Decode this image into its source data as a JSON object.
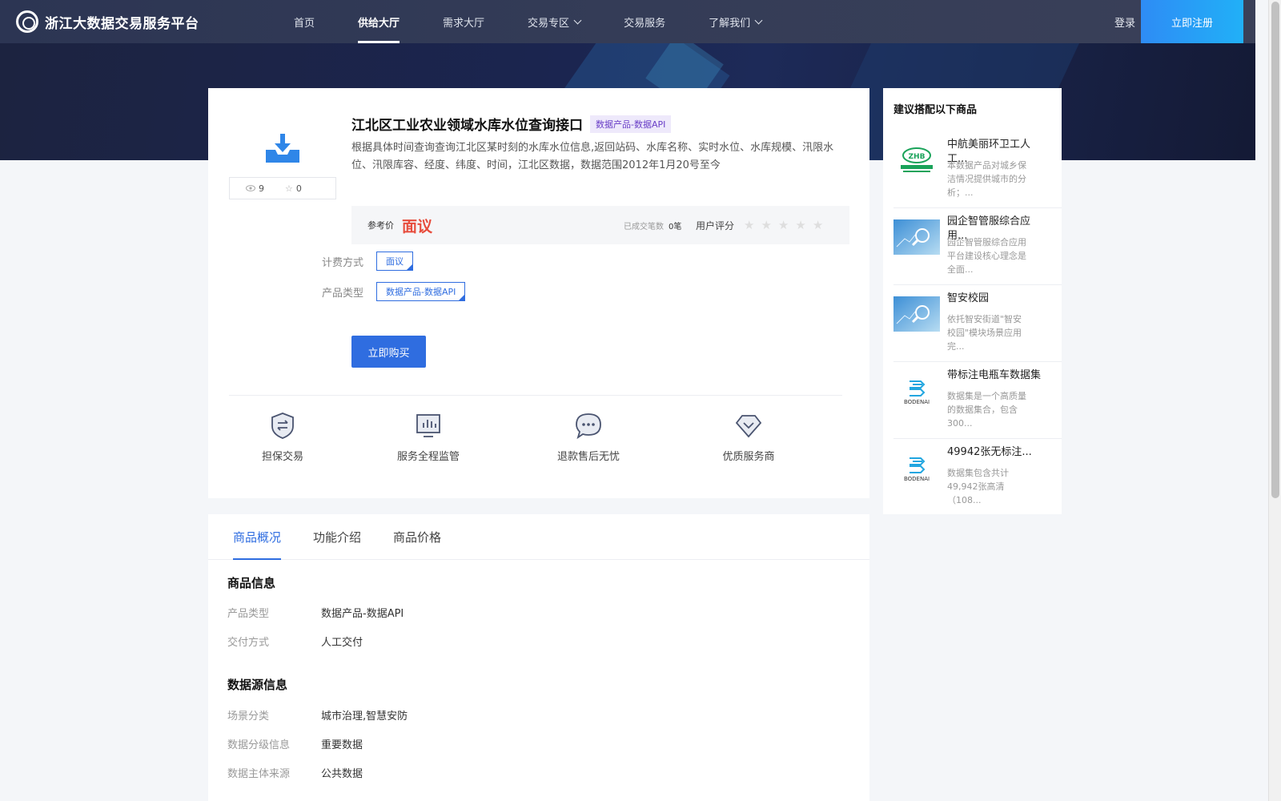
{
  "header": {
    "logo_text": "浙江大数据交易服务平台",
    "nav": [
      {
        "label": "首页"
      },
      {
        "label": "供给大厅"
      },
      {
        "label": "需求大厅"
      },
      {
        "label": "交易专区"
      },
      {
        "label": "交易服务"
      },
      {
        "label": "了解我们"
      }
    ],
    "login": "登录",
    "register": "立即注册"
  },
  "product": {
    "title": "江北区工业农业领域水库水位查询接口",
    "tag": "数据产品-数据API",
    "description": "根据具体时间查询查询江北区某时刻的水库水位信息,返回站码、水库名称、实时水位、水库规模、汛限水位、汛限库容、经度、纬度、时间，江北区数据，数据范围2012年1月20号至今",
    "views": "9",
    "favorites": "0",
    "price_label": "参考价",
    "price_value": "面议",
    "deal_label": "已成交笔数",
    "deal_value": "0笔",
    "rating_label": "用户评分",
    "billing_label": "计费方式",
    "billing_value": "面议",
    "type_label": "产品类型",
    "type_value": "数据产品-数据API",
    "buy_label": "立即购买"
  },
  "features": [
    {
      "label": "担保交易",
      "icon": "shield-swap-icon"
    },
    {
      "label": "服务全程监管",
      "icon": "monitor-chart-icon"
    },
    {
      "label": "退款售后无忧",
      "icon": "chat-bubble-icon"
    },
    {
      "label": "优质服务商",
      "icon": "diamond-icon"
    }
  ],
  "tabs": [
    {
      "label": "商品概况"
    },
    {
      "label": "功能介绍"
    },
    {
      "label": "商品价格"
    }
  ],
  "info": {
    "section1_title": "商品信息",
    "section1": [
      {
        "k": "产品类型",
        "v": "数据产品-数据API"
      },
      {
        "k": "交付方式",
        "v": "人工交付"
      }
    ],
    "section2_title": "数据源信息",
    "section2": [
      {
        "k": "场景分类",
        "v": "城市治理,智慧安防"
      },
      {
        "k": "数据分级信息",
        "v": "重要数据"
      },
      {
        "k": "数据主体来源",
        "v": "公共数据"
      }
    ]
  },
  "sidebar": {
    "title": "建议搭配以下商品",
    "items": [
      {
        "name": "中航美丽环卫工人工...",
        "desc": "本数据产品对城乡保洁情况提供城市的分析；...",
        "thumb": "zhb-logo"
      },
      {
        "name": "园企智管服综合应用...",
        "desc": "园企智管服综合应用平台建设核心理念是全面...",
        "thumb": "data-magnifier"
      },
      {
        "name": "智安校园",
        "desc": "依托智安街道\"智安校园\"模块场景应用 完...",
        "thumb": "data-magnifier"
      },
      {
        "name": "带标注电瓶车数据集",
        "desc": "数据集是一个高质量的数据集合，包含300...",
        "thumb": "boden-logo"
      },
      {
        "name": "49942张无标注...",
        "desc": "数据集包含共计49,942张高清（108...",
        "thumb": "boden-logo"
      }
    ]
  },
  "colors": {
    "accent": "#2f6de0",
    "price": "#e74c3c",
    "header_bg": "#2c3553"
  }
}
